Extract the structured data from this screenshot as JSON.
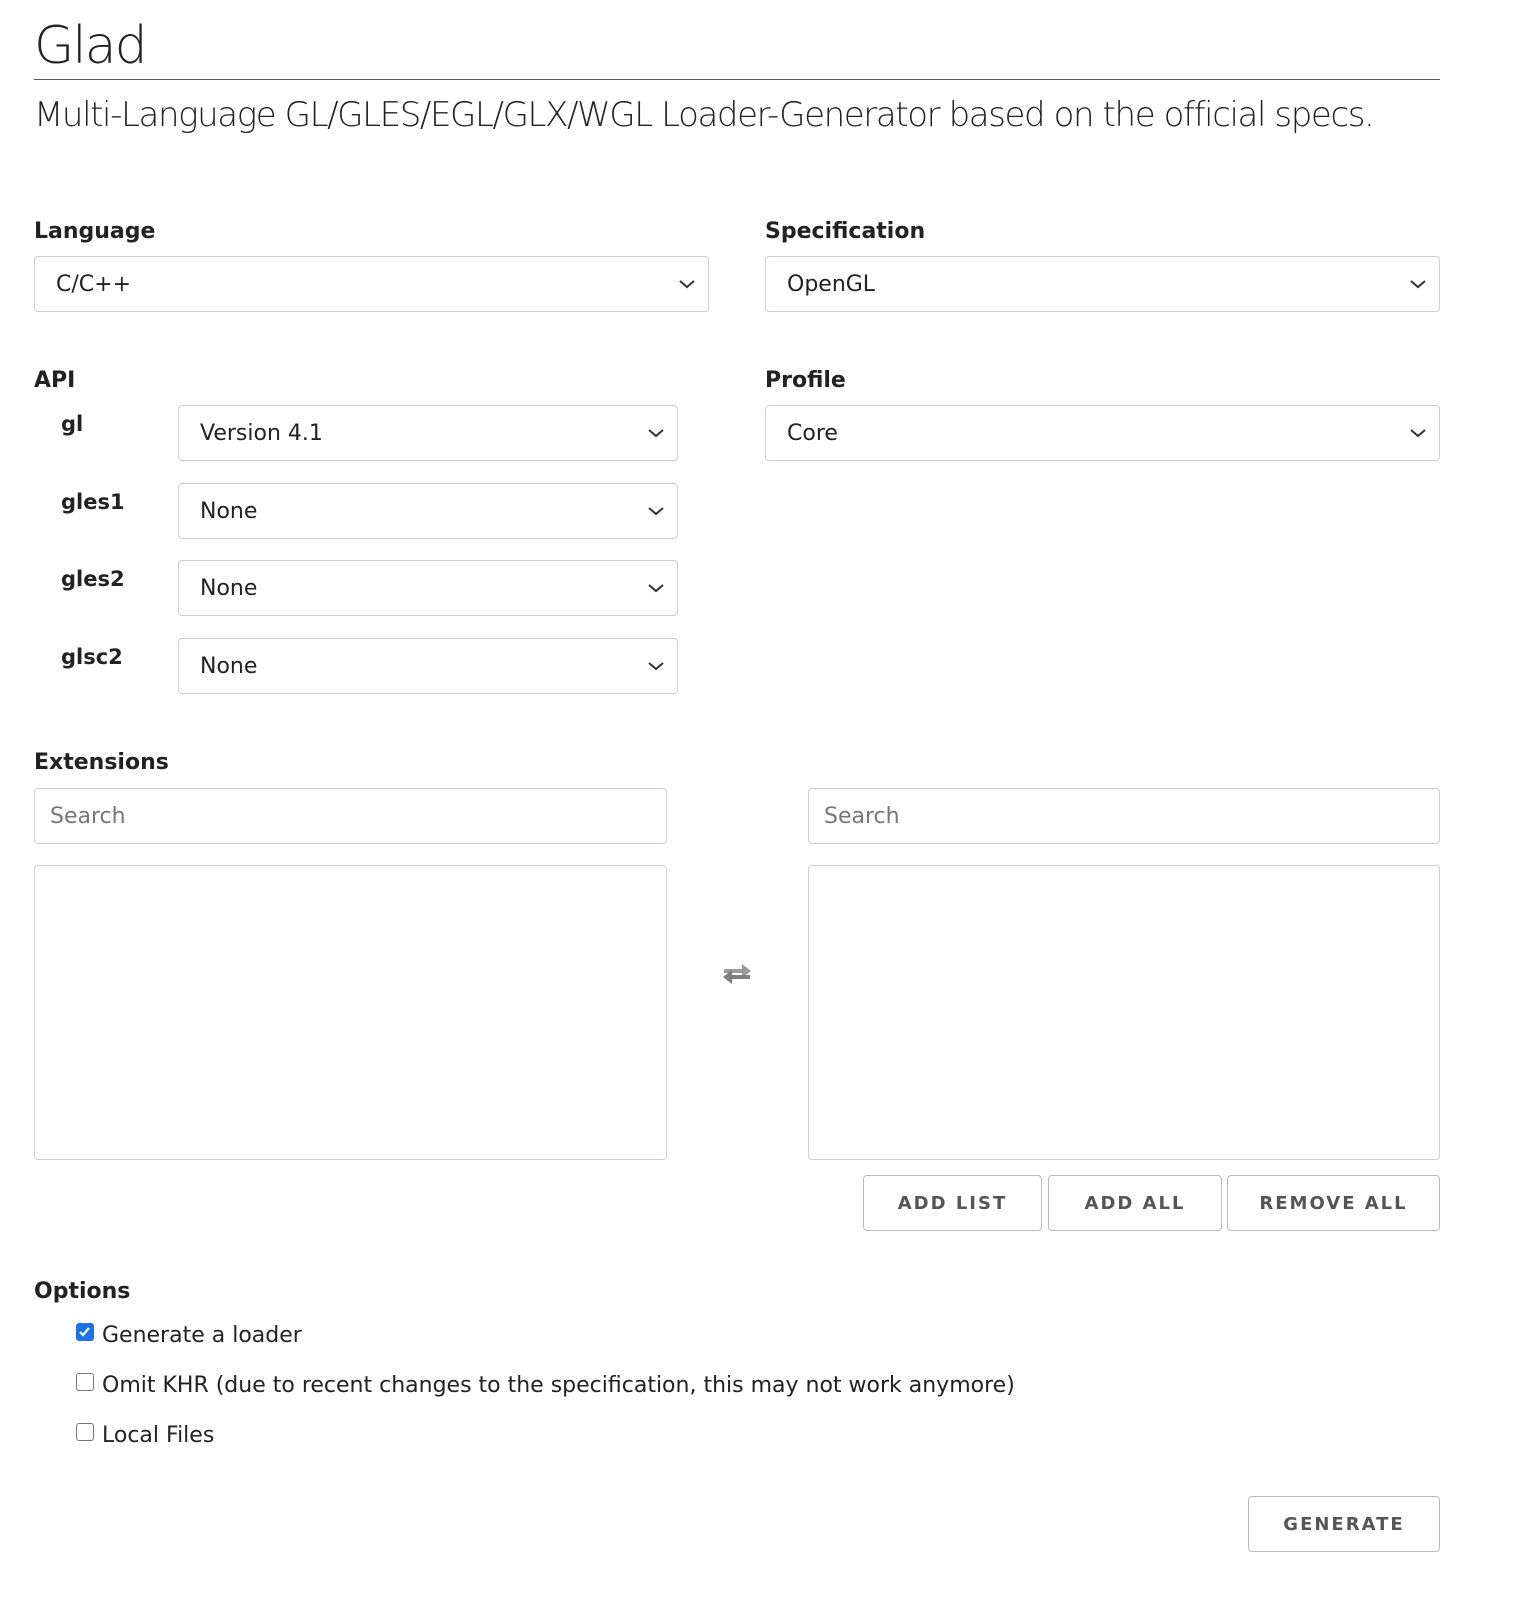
{
  "header": {
    "title": "Glad",
    "subtitle": "Multi-Language GL/GLES/EGL/GLX/WGL Loader-Generator based on the official specs."
  },
  "language": {
    "label": "Language",
    "selected": "C/C++"
  },
  "specification": {
    "label": "Specification",
    "selected": "OpenGL"
  },
  "api": {
    "label": "API",
    "rows": [
      {
        "name": "gl",
        "selected": "Version 4.1"
      },
      {
        "name": "gles1",
        "selected": "None"
      },
      {
        "name": "gles2",
        "selected": "None"
      },
      {
        "name": "glsc2",
        "selected": "None"
      }
    ]
  },
  "profile": {
    "label": "Profile",
    "selected": "Core"
  },
  "extensions": {
    "label": "Extensions",
    "left_search_placeholder": "Search",
    "right_search_placeholder": "Search",
    "swap_icon": "swap-arrows-icon",
    "buttons": {
      "add_list": "ADD LIST",
      "add_all": "ADD ALL",
      "remove_all": "REMOVE ALL"
    }
  },
  "options": {
    "label": "Options",
    "items": [
      {
        "label": "Generate a loader",
        "checked": true
      },
      {
        "label": "Omit KHR (due to recent changes to the specification, this may not work anymore)",
        "checked": false
      },
      {
        "label": "Local Files",
        "checked": false
      }
    ]
  },
  "generate_label": "GENERATE",
  "colors": {
    "checkbox_checked": "#1a73e8",
    "border": "#cfcfcf",
    "button_text": "#555555"
  }
}
